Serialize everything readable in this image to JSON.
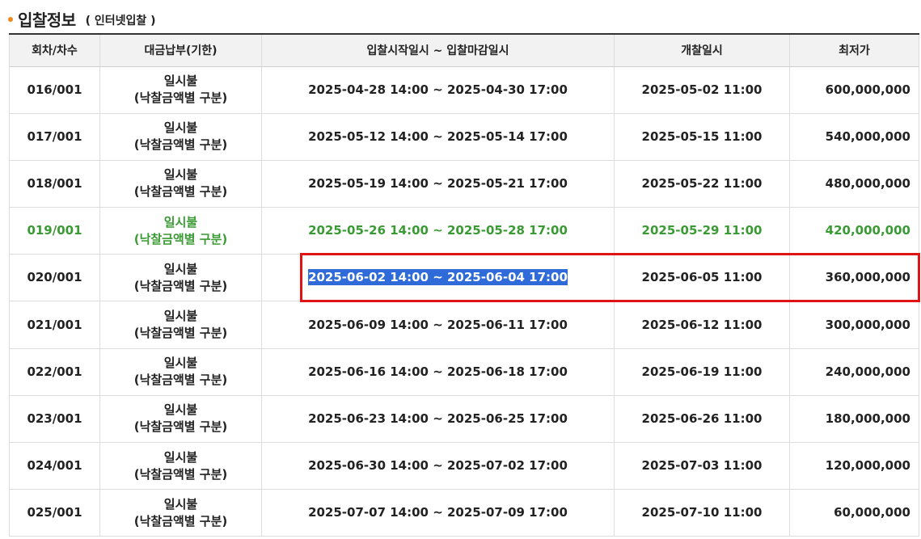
{
  "header": {
    "title": "입찰정보",
    "subtitle": "( 인터넷입찰 )"
  },
  "columns": [
    "회차/차수",
    "대금납부(기한)",
    "입찰시작일시 ~ 입찰마감일시",
    "개찰일시",
    "최저가"
  ],
  "rows": [
    {
      "round": "016/001",
      "payment": "일시불",
      "payment_note": "(낙찰금액별 구분)",
      "period": "2025-04-28 14:00 ~ 2025-04-30 17:00",
      "opening": "2025-05-02 11:00",
      "price": "600,000,000"
    },
    {
      "round": "017/001",
      "payment": "일시불",
      "payment_note": "(낙찰금액별 구분)",
      "period": "2025-05-12 14:00 ~ 2025-05-14 17:00",
      "opening": "2025-05-15 11:00",
      "price": "540,000,000"
    },
    {
      "round": "018/001",
      "payment": "일시불",
      "payment_note": "(낙찰금액별 구분)",
      "period": "2025-05-19 14:00 ~ 2025-05-21 17:00",
      "opening": "2025-05-22 11:00",
      "price": "480,000,000"
    },
    {
      "round": "019/001",
      "payment": "일시불",
      "payment_note": "(낙찰금액별 구분)",
      "period": "2025-05-26 14:00 ~ 2025-05-28 17:00",
      "opening": "2025-05-29 11:00",
      "price": "420,000,000"
    },
    {
      "round": "020/001",
      "payment": "일시불",
      "payment_note": "(낙찰금액별 구분)",
      "period": "2025-06-02 14:00 ~ 2025-06-04 17:00",
      "opening": "2025-06-05 11:00",
      "price": "360,000,000"
    },
    {
      "round": "021/001",
      "payment": "일시불",
      "payment_note": "(낙찰금액별 구분)",
      "period": "2025-06-09 14:00 ~ 2025-06-11 17:00",
      "opening": "2025-06-12 11:00",
      "price": "300,000,000"
    },
    {
      "round": "022/001",
      "payment": "일시불",
      "payment_note": "(낙찰금액별 구분)",
      "period": "2025-06-16 14:00 ~ 2025-06-18 17:00",
      "opening": "2025-06-19 11:00",
      "price": "240,000,000"
    },
    {
      "round": "023/001",
      "payment": "일시불",
      "payment_note": "(낙찰금액별 구분)",
      "period": "2025-06-23 14:00 ~ 2025-06-25 17:00",
      "opening": "2025-06-26 11:00",
      "price": "180,000,000"
    },
    {
      "round": "024/001",
      "payment": "일시불",
      "payment_note": "(낙찰금액별 구분)",
      "period": "2025-06-30 14:00 ~ 2025-07-02 17:00",
      "opening": "2025-07-03 11:00",
      "price": "120,000,000"
    },
    {
      "round": "025/001",
      "payment": "일시불",
      "payment_note": "(낙찰금액별 구분)",
      "period": "2025-07-07 14:00 ~ 2025-07-09 17:00",
      "opening": "2025-07-10 11:00",
      "price": "60,000,000"
    }
  ],
  "colors": {
    "accent_bullet": "#f08a1c",
    "current_row_text": "#3a9a34",
    "selection_bg": "#2f6bd8",
    "highlight_box": "#e01414"
  }
}
